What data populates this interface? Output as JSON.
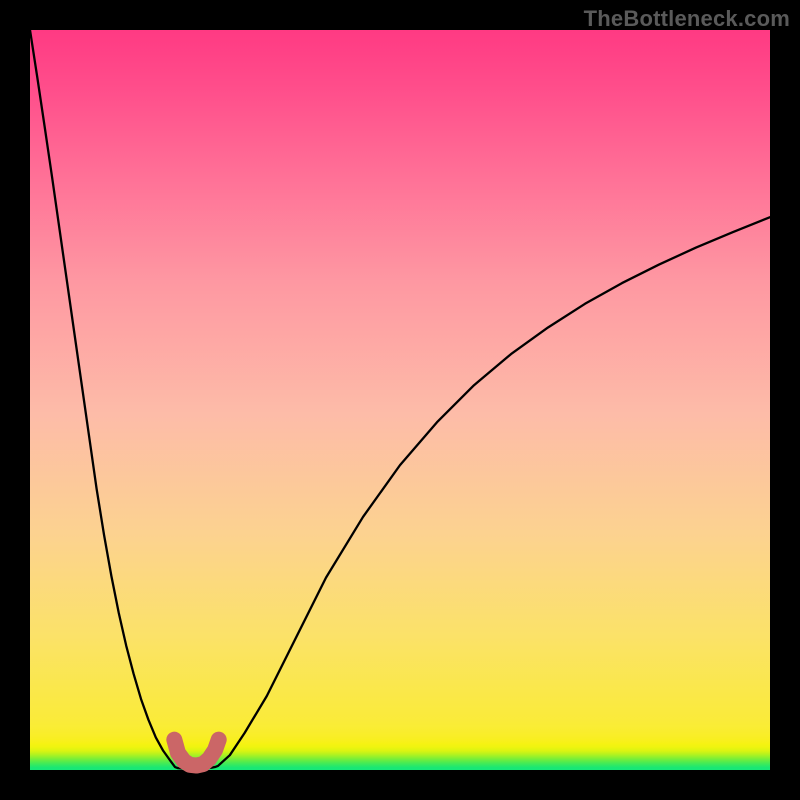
{
  "watermark": "TheBottleneck.com",
  "chart_data": {
    "type": "line",
    "title": "",
    "xlabel": "",
    "ylabel": "",
    "xlim": [
      0,
      1
    ],
    "ylim": [
      0,
      1
    ],
    "series": [
      {
        "name": "curve-left",
        "x": [
          0.0,
          0.01,
          0.02,
          0.03,
          0.04,
          0.05,
          0.06,
          0.07,
          0.08,
          0.09,
          0.1,
          0.11,
          0.12,
          0.13,
          0.14,
          0.15,
          0.16,
          0.17,
          0.18,
          0.19,
          0.196
        ],
        "y": [
          1.0,
          0.935,
          0.868,
          0.8,
          0.73,
          0.66,
          0.59,
          0.52,
          0.45,
          0.38,
          0.318,
          0.262,
          0.212,
          0.168,
          0.13,
          0.096,
          0.068,
          0.044,
          0.026,
          0.012,
          0.004
        ]
      },
      {
        "name": "notch",
        "x": [
          0.196,
          0.2,
          0.205,
          0.212,
          0.22,
          0.23,
          0.238,
          0.245,
          0.25,
          0.254
        ],
        "y": [
          0.004,
          0.0025,
          0.002,
          0.0018,
          0.0018,
          0.002,
          0.0024,
          0.003,
          0.004,
          0.0055
        ]
      },
      {
        "name": "curve-right",
        "x": [
          0.254,
          0.27,
          0.29,
          0.32,
          0.35,
          0.4,
          0.45,
          0.5,
          0.55,
          0.6,
          0.65,
          0.7,
          0.75,
          0.8,
          0.85,
          0.9,
          0.95,
          1.0
        ],
        "y": [
          0.0055,
          0.02,
          0.05,
          0.1,
          0.16,
          0.26,
          0.342,
          0.412,
          0.47,
          0.52,
          0.562,
          0.598,
          0.63,
          0.658,
          0.683,
          0.706,
          0.727,
          0.747
        ]
      },
      {
        "name": "notch-highlight",
        "stroke": "#cb6667",
        "stroke_width": 16,
        "x": [
          0.195,
          0.2,
          0.208,
          0.216,
          0.225,
          0.234,
          0.242,
          0.25,
          0.255
        ],
        "y": [
          0.041,
          0.023,
          0.012,
          0.007,
          0.006,
          0.008,
          0.015,
          0.027,
          0.041
        ]
      }
    ],
    "gradient_stops": [
      {
        "offset": 0.0,
        "color": "#17e876"
      },
      {
        "offset": 0.03,
        "color": "#eef40f"
      },
      {
        "offset": 0.18,
        "color": "#fbe268"
      },
      {
        "offset": 0.5,
        "color": "#fdbca8"
      },
      {
        "offset": 1.0,
        "color": "#ff3a83"
      }
    ]
  },
  "colors": {
    "background": "#000000",
    "curve": "#000000",
    "notch_highlight": "#cb6667"
  }
}
